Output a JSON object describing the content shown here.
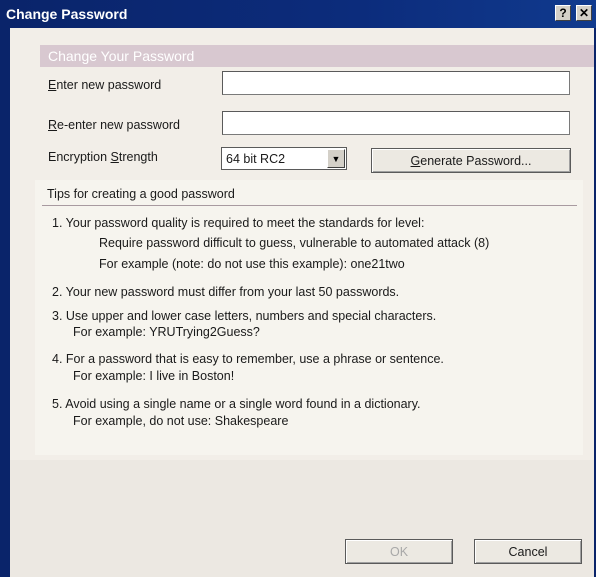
{
  "window": {
    "title": "Change Password",
    "help_glyph": "?",
    "close_glyph": "✕"
  },
  "banner": "Change Your Password",
  "form": {
    "new_password_label": "Enter new password",
    "new_password_accel": "E",
    "new_password_rest": "nter new password",
    "new_password_value": "",
    "reenter_accel": "R",
    "reenter_rest": "e-enter new password",
    "reenter_value": "",
    "encryption_prefix": "Encryption ",
    "encryption_accel": "S",
    "encryption_rest": "trength",
    "encryption_value": "64 bit RC2",
    "generate_accel": "G",
    "generate_rest": "enerate Password..."
  },
  "tips": {
    "title": "Tips for creating a good password",
    "items": [
      {
        "line1": "1.  Your password quality is required to meet the standards for level:",
        "line2": "Require password difficult to guess, vulnerable to automated attack (8)",
        "line3": "For example (note: do not use this example):  one21two"
      },
      {
        "line1": "2.  Your new password must differ from your last 50 passwords."
      },
      {
        "line1": "3.  Use upper and lower case letters, numbers and special characters.",
        "line2": "For example:  YRUTrying2Guess?"
      },
      {
        "line1": "4.  For a password that is easy to remember, use a phrase or sentence.",
        "line2": "For example:  I live in Boston!"
      },
      {
        "line1": "5.  Avoid using a single name or a single word found in a dictionary.",
        "line2": "For example, do not use:  Shakespeare"
      }
    ]
  },
  "buttons": {
    "ok": "OK",
    "cancel": "Cancel"
  },
  "colors": {
    "titlebar": "#0a246a",
    "banner": "#d8c8d0",
    "client": "#f2eee8"
  }
}
